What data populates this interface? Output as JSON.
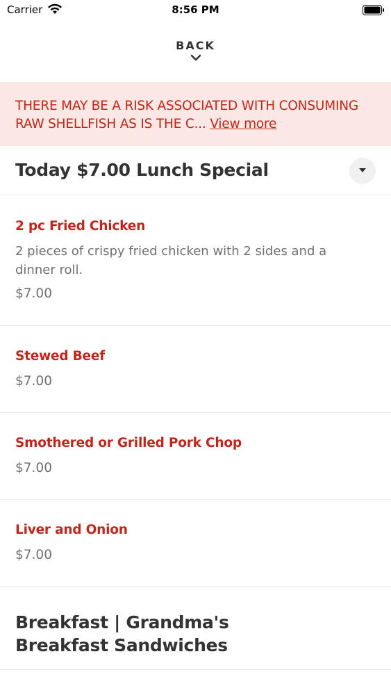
{
  "status_bar": {
    "carrier": "Carrier",
    "time": "8:56 PM"
  },
  "nav": {
    "back_label": "BACK"
  },
  "warning": {
    "text": "THERE MAY BE A RISK ASSOCIATED WITH CONSUMING RAW SHELLFISH AS IS THE C...",
    "view_more": "View more"
  },
  "section1": {
    "title": "Today $7.00 Lunch Special",
    "items": [
      {
        "name": "2 pc Fried Chicken",
        "description": "2 pieces of crispy fried chicken with 2 sides and a dinner roll.",
        "price": "$7.00"
      },
      {
        "name": "Stewed Beef",
        "price": "$7.00"
      },
      {
        "name": "Smothered or Grilled Pork Chop",
        "price": "$7.00"
      },
      {
        "name": "Liver and Onion",
        "price": "$7.00"
      }
    ]
  },
  "section2": {
    "title": "Breakfast | Grandma's Breakfast Sandwiches"
  },
  "colors": {
    "accent_red": "#c0261b",
    "warning_bg": "#fbe7e3",
    "muted_text": "#707070"
  },
  "icons": [
    "wifi-icon",
    "battery-icon",
    "chevron-down-icon",
    "dropdown-caret-icon"
  ]
}
